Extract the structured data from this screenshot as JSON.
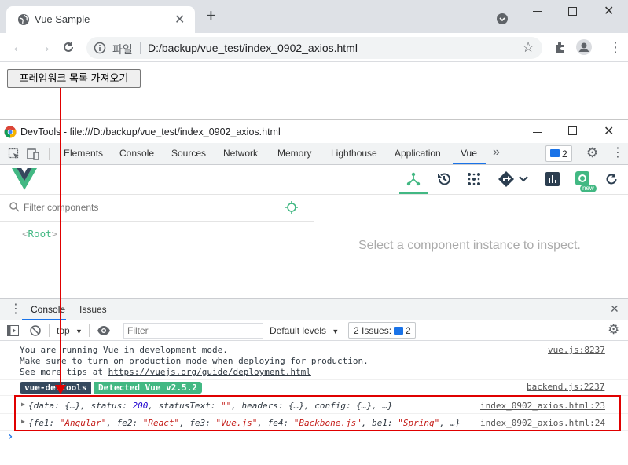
{
  "browser": {
    "tab_title": "Vue Sample",
    "new_tab": "+",
    "address_prefix": "파일",
    "address": "D:/backup/vue_test/index_0902_axios.html"
  },
  "page": {
    "fetch_button": "프레임워크 목록 가져오기"
  },
  "devtools": {
    "title": "DevTools - file:///D:/backup/vue_test/index_0902_axios.html",
    "tabs": [
      "Elements",
      "Console",
      "Sources",
      "Network",
      "Memory",
      "Lighthouse",
      "Application",
      "Vue"
    ],
    "active_tab": "Vue",
    "more_tabs": "»",
    "issues_badge": "2",
    "vue": {
      "filter_placeholder": "Filter components",
      "root_component": "Root",
      "inspect_hint": "Select a component instance to inspect.",
      "new_badge": "new"
    },
    "drawer": {
      "tabs": [
        "Console",
        "Issues"
      ],
      "context": "top",
      "filter_placeholder": "Filter",
      "levels": "Default levels",
      "issues_label": "2 Issues:",
      "issues_count": "2"
    },
    "console": {
      "dev_mode": {
        "line1": "You are running Vue in development mode.",
        "line2": "Make sure to turn on production mode when deploying for production.",
        "line3_prefix": "See more tips at ",
        "line3_link": "https://vuejs.org/guide/deployment.html",
        "source": "vue.js:8237"
      },
      "devtools_badge": {
        "left": "vue-devtools",
        "right": "Detected Vue v2.5.2",
        "source": "backend.js:2237"
      },
      "log1": {
        "p1": "{data: {…}, status: ",
        "status": "200",
        "p2": ", statusText: ",
        "statusText": "\"\"",
        "p3": ", headers: {…}, config: {…}, …}",
        "source": "index_0902_axios.html:23"
      },
      "log2": {
        "open": "{",
        "k1": "fe1: ",
        "v1": "\"Angular\"",
        "k2": ", fe2: ",
        "v2": "\"React\"",
        "k3": ", fe3: ",
        "v3": "\"Vue.js\"",
        "k4": ", fe4: ",
        "v4": "\"Backbone.js\"",
        "k5": ", be1: ",
        "v5": "\"Spring\"",
        "close": ", …}",
        "source": "index_0902_axios.html:24"
      },
      "prompt": "›"
    }
  },
  "colors": {
    "vue_green": "#42b883",
    "vue_dark": "#35495e",
    "annotation_red": "#e00000",
    "string_red": "#c41a16",
    "number_blue": "#1c00cf"
  }
}
